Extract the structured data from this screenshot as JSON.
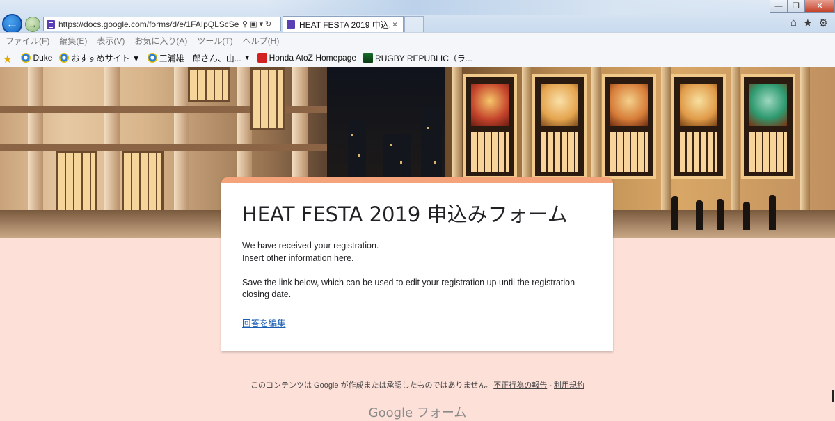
{
  "browser": {
    "address": "https://docs.google.com/forms/d/e/1FAIpQLScSe",
    "tab_title": "HEAT FESTA 2019 申込...",
    "tab_close": "×",
    "menu": [
      "ファイル(F)",
      "編集(E)",
      "表示(V)",
      "お気に入り(A)",
      "ツール(T)",
      "ヘルプ(H)"
    ],
    "favorites": [
      {
        "label": "Duke",
        "icon": "ie-icon"
      },
      {
        "label": "おすすめサイト ▼",
        "icon": "ie-icon"
      },
      {
        "label": "三浦雄一郎さん、山...",
        "icon": "ie-icon"
      },
      {
        "label": "Honda AtoZ Homepage",
        "icon": "honda-icon"
      },
      {
        "label": "RUGBY REPUBLIC（ラ...",
        "icon": "rugby-icon"
      }
    ],
    "favorites_more": "▼",
    "window_buttons": {
      "minimize": "—",
      "maximize": "❐",
      "close": "✕"
    },
    "toolbar_icons": [
      "home-icon",
      "star-icon",
      "gear-icon"
    ],
    "address_icons": [
      "search-icon",
      "lock-icon",
      "dropdown-icon",
      "refresh-icon"
    ]
  },
  "form": {
    "title": "HEAT FESTA 2019 申込みフォーム",
    "accent_color": "#f4a37a",
    "background_color": "#fde1d9",
    "lines": [
      "We have received your registration.",
      "Insert other information here.",
      "Save the link below, which can be used to edit your registration up until the registration",
      "closing date."
    ],
    "edit_link": "回答を編集"
  },
  "footer": {
    "disclaimer": "このコンテンツは Google が作成または承認したものではありません。",
    "report_link": "不正行為の報告",
    "separator": " - ",
    "terms_link": "利用規約",
    "logo": "Google フォーム"
  }
}
